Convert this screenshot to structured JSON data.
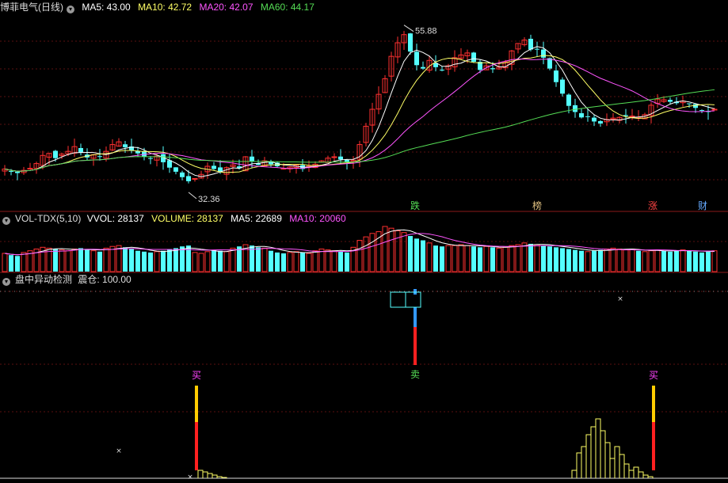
{
  "panels": {
    "price": {
      "title": "博菲电气(日线)",
      "ma": [
        {
          "label": "MA5: 43.00",
          "color": "#ffffff"
        },
        {
          "label": "MA10: 42.72",
          "color": "#ffff66"
        },
        {
          "label": "MA20: 42.07",
          "color": "#ff55ff"
        },
        {
          "label": "MA60: 44.17",
          "color": "#55dd55"
        }
      ],
      "high_label": "55.88",
      "low_label": "32.36",
      "events": [
        {
          "text": "跌",
          "color": "#55dd55"
        },
        {
          "text": "榜",
          "color": "#e0c080"
        },
        {
          "text": "涨",
          "color": "#ff4444"
        },
        {
          "text": "财",
          "color": "#66aaff"
        }
      ]
    },
    "volume": {
      "title": "VOL-TDX(5,10)",
      "items": [
        {
          "label": "VVOL: 28137",
          "color": "#ffffff"
        },
        {
          "label": "VOLUME: 28137",
          "color": "#ffff66"
        },
        {
          "label": "MA5: 22689",
          "color": "#ffffff"
        },
        {
          "label": "MA10: 20060",
          "color": "#ff55ff"
        }
      ]
    },
    "detector": {
      "title": "盘中异动检测",
      "pos_label": "震仓: 100.00",
      "signals": [
        {
          "text": "买",
          "color": "#ff44ff"
        },
        {
          "text": "卖",
          "color": "#55dd55"
        },
        {
          "text": "买",
          "color": "#ff44ff"
        }
      ]
    }
  },
  "chart_data": {
    "type": "candlestick",
    "ylim": [
      30,
      58
    ],
    "closes": [
      35.2,
      34.8,
      34.6,
      35.0,
      35.3,
      36.0,
      37.2,
      37.5,
      36.8,
      37.4,
      37.8,
      38.5,
      37.6,
      36.9,
      37.3,
      37.0,
      37.8,
      38.8,
      39.2,
      38.4,
      37.9,
      37.5,
      37.0,
      36.8,
      37.1,
      36.2,
      35.4,
      34.8,
      34.0,
      33.4,
      33.8,
      34.4,
      35.6,
      35.2,
      34.8,
      35.4,
      35.8,
      35.3,
      37.0,
      36.3,
      35.8,
      36.4,
      35.9,
      35.6,
      35.3,
      35.5,
      35.8,
      35.2,
      35.6,
      35.9,
      36.4,
      36.8,
      37.0,
      36.6,
      36.2,
      36.5,
      38.8,
      41.5,
      44.0,
      46.2,
      48.5,
      51.8,
      53.8,
      55.0,
      52.5,
      50.5,
      50.0,
      51.2,
      50.2,
      49.8,
      50.4,
      51.6,
      52.0,
      52.3,
      51.0,
      49.8,
      50.4,
      49.9,
      50.2,
      51.0,
      52.6,
      53.7,
      54.2,
      52.8,
      52.9,
      51.6,
      50.0,
      48.0,
      46.3,
      44.5,
      43.6,
      42.8,
      42.9,
      42.2,
      41.9,
      42.5,
      42.7,
      42.8,
      43.0,
      43.0,
      42.8,
      43.2,
      44.6,
      45.5,
      45.4,
      45.1,
      44.9,
      45.2,
      44.8,
      44.2,
      43.8,
      43.6,
      44.0
    ],
    "volume": [
      21,
      19,
      18,
      22,
      24,
      26,
      28,
      27,
      26,
      25,
      24,
      26,
      27,
      25,
      24,
      23,
      27,
      29,
      30,
      28,
      26,
      24,
      23,
      22,
      23,
      24,
      26,
      27,
      29,
      30,
      22,
      21,
      23,
      25,
      24,
      23,
      27,
      29,
      31,
      30,
      28,
      27,
      24,
      22,
      21,
      22,
      23,
      22,
      21,
      24,
      26,
      25,
      24,
      23,
      22,
      28,
      36,
      40,
      44,
      46,
      52,
      50,
      47,
      45,
      41,
      38,
      36,
      33,
      30,
      29,
      30,
      30,
      31,
      30,
      29,
      28,
      29,
      28,
      27,
      28,
      30,
      31,
      33,
      32,
      31,
      30,
      29,
      28,
      27,
      26,
      25,
      24,
      23,
      24,
      25,
      26,
      27,
      26,
      25,
      26,
      24,
      23,
      24,
      25,
      24,
      23,
      24,
      25,
      24,
      23,
      22,
      23,
      24
    ],
    "ma_series": [
      "MA5",
      "MA10",
      "MA20",
      "MA60"
    ],
    "signals": [
      "买",
      "卖",
      "买"
    ]
  }
}
